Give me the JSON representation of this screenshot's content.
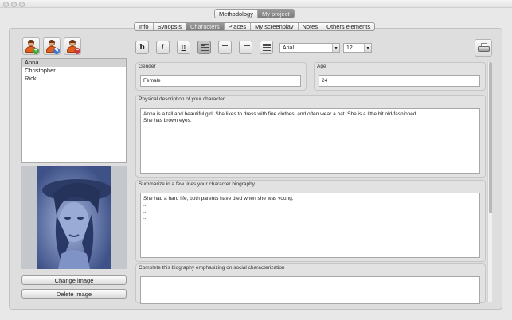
{
  "window": {
    "mode_tabs": [
      {
        "label": "Methodology",
        "active": false
      },
      {
        "label": "My project",
        "active": true
      }
    ]
  },
  "section_tabs": [
    {
      "label": "Info",
      "active": false
    },
    {
      "label": "Synopsis",
      "active": false
    },
    {
      "label": "Characters",
      "active": true
    },
    {
      "label": "Places",
      "active": false
    },
    {
      "label": "My screenplay",
      "active": false
    },
    {
      "label": "Notes",
      "active": false
    },
    {
      "label": "Others elements",
      "active": false
    }
  ],
  "character_buttons": [
    {
      "icon": "add-character-icon"
    },
    {
      "icon": "edit-character-icon"
    },
    {
      "icon": "delete-character-icon"
    }
  ],
  "characters": [
    "Anna",
    "Christopher",
    "Rick"
  ],
  "selected_character": "Anna",
  "image_buttons": {
    "change": "Change image",
    "delete": "Delete image"
  },
  "toolbar": {
    "bold": "b",
    "italic": "i",
    "underline": "u",
    "font": "Arial",
    "size": "12",
    "align_icons": [
      "align-left-icon",
      "align-center-icon",
      "align-right-icon",
      "align-justify-icon"
    ],
    "print_icon": "printer-icon"
  },
  "fields": {
    "gender": {
      "label": "Gender",
      "value": "Female"
    },
    "age": {
      "label": "Age",
      "value": "24"
    },
    "physical": {
      "label": "Physical description of your character",
      "lines": [
        "Anna is a tall and beautiful girl. She likes to dress with fine clothes, and often wear a hat. She is a little bit old-fashioned.",
        "She has brown eyes."
      ]
    },
    "biography": {
      "label": "Summarize in a few lines your character biography",
      "lines": [
        "She had a hard life, both parents have died when she was young.",
        "...",
        "...",
        "..."
      ]
    },
    "social": {
      "label": "Complete this biography emphasizing on social characterization",
      "lines": [
        "..."
      ]
    }
  }
}
